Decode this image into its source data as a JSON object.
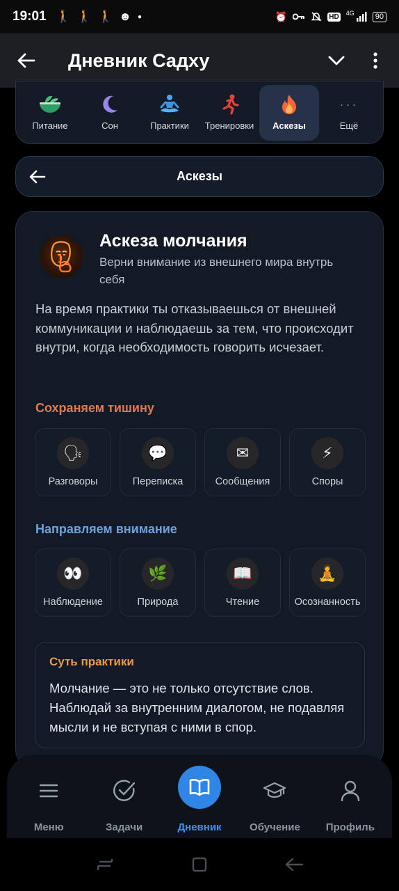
{
  "status": {
    "time": "19:01",
    "hd": "HD",
    "signal": "4G",
    "battery": "90"
  },
  "app_bar": {
    "title": "Дневник Садху"
  },
  "tabs": [
    {
      "label": "Питание",
      "icon": "bowl-icon"
    },
    {
      "label": "Сон",
      "icon": "moon-icon"
    },
    {
      "label": "Практики",
      "icon": "meditation-icon"
    },
    {
      "label": "Тренировки",
      "icon": "running-icon"
    },
    {
      "label": "Аскезы",
      "icon": "flame-icon",
      "active": true
    },
    {
      "label": "Ещё",
      "icon": "more-icon"
    }
  ],
  "section": {
    "title": "Аскезы"
  },
  "ascesis": {
    "title": "Аскеза молчания",
    "subtitle": "Верни внимание из внешнего мира внутрь себя",
    "description": "На время практики ты отказываешься от внешней коммуникации и наблюдаешь за тем, что происходит внутри, когда необходимость говорить исчезает.",
    "silence": {
      "title": "Сохраняем тишину",
      "items": [
        {
          "label": "Разговоры",
          "icon": "speaking-head-icon",
          "glyph": "🗣"
        },
        {
          "label": "Переписка",
          "icon": "speech-bubble-icon",
          "glyph": "💬"
        },
        {
          "label": "Сообщения",
          "icon": "envelope-icon",
          "glyph": "✉"
        },
        {
          "label": "Споры",
          "icon": "lightning-icon",
          "glyph": "⚡"
        }
      ]
    },
    "attention": {
      "title": "Направляем внимание",
      "items": [
        {
          "label": "Наблюдение",
          "icon": "eyes-icon",
          "glyph": "👀"
        },
        {
          "label": "Природа",
          "icon": "herb-icon",
          "glyph": "🌿"
        },
        {
          "label": "Чтение",
          "icon": "book-icon",
          "glyph": "📖"
        },
        {
          "label": "Осознанность",
          "icon": "lotus-position-icon",
          "glyph": "🧘"
        }
      ]
    },
    "essence": {
      "title": "Суть практики",
      "text": "Молчание — это не только отсутствие слов. Наблюдай за внутренним диалогом, не подавляя мысли и не вступая с ними в спор."
    }
  },
  "bottom_nav": [
    {
      "label": "Меню",
      "icon": "menu-icon"
    },
    {
      "label": "Задачи",
      "icon": "check-circle-icon"
    },
    {
      "label": "Дневник",
      "icon": "open-book-icon",
      "active": true
    },
    {
      "label": "Обучение",
      "icon": "graduation-cap-icon"
    },
    {
      "label": "Профиль",
      "icon": "user-icon"
    }
  ],
  "colors": {
    "accent_blue": "#2f86e6",
    "silence_title": "#e07a52",
    "attention_title": "#6aa3e0",
    "essence_title": "#e69a4e"
  }
}
